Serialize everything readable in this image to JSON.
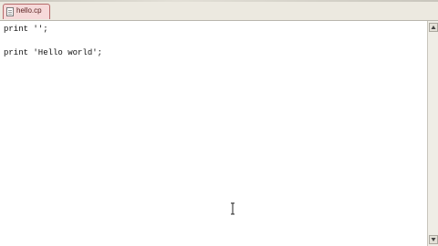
{
  "tab": {
    "label": "hello.cp",
    "active_color": "#f6d9d9",
    "icon": "document-icon"
  },
  "editor": {
    "lines": [
      "print '';",
      "",
      "print 'Hello world';"
    ],
    "cursor_icon": "i-beam-cursor-icon"
  },
  "scrollbar": {
    "up_icon": "arrow-up-icon",
    "down_icon": "arrow-down-icon"
  }
}
